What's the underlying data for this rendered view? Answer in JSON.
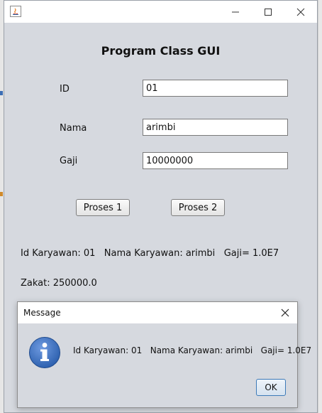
{
  "window": {
    "title": "",
    "app_title": "Program Class GUI"
  },
  "form": {
    "id_label": "ID",
    "id_value": "01",
    "nama_label": "Nama",
    "nama_value": "arimbi",
    "gaji_label": "Gaji",
    "gaji_value": "10000000"
  },
  "buttons": {
    "proses1": "Proses 1",
    "proses2": "Proses 2"
  },
  "output": {
    "line1": "Id Karyawan: 01   Nama Karyawan: arimbi   Gaji= 1.0E7",
    "line2": "Zakat: 250000.0"
  },
  "dialog": {
    "title": "Message",
    "message": "Id Karyawan: 01   Nama Karyawan: arimbi   Gaji= 1.0E7",
    "ok_label": "OK",
    "icon": "information-icon"
  },
  "colors": {
    "frame_bg": "#d6d9df",
    "info_icon_blue": "#2f62b0"
  }
}
